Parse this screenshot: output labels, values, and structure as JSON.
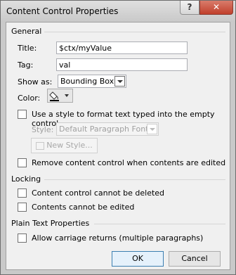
{
  "window": {
    "title": "Content Control Properties",
    "help_glyph": "?",
    "close_glyph": "✕"
  },
  "general": {
    "heading": "General",
    "title_label": "Title:",
    "title_value": "$ctx/myValue",
    "tag_label": "Tag:",
    "tag_value": "val",
    "showas_label": "Show as:",
    "showas_value": "Bounding Box",
    "color_label": "Color:",
    "use_style_label": "Use a style to format text typed into the empty control",
    "style_label": "Style:",
    "style_value": "Default Paragraph Font",
    "new_style_label": "New Style...",
    "remove_label": "Remove content control when contents are edited"
  },
  "locking": {
    "heading": "Locking",
    "cannot_delete_label": "Content control cannot be deleted",
    "cannot_edit_label": "Contents cannot be edited"
  },
  "plain_text": {
    "heading": "Plain Text Properties",
    "carriage_label": "Allow carriage returns (multiple paragraphs)"
  },
  "buttons": {
    "ok": "OK",
    "cancel": "Cancel"
  }
}
